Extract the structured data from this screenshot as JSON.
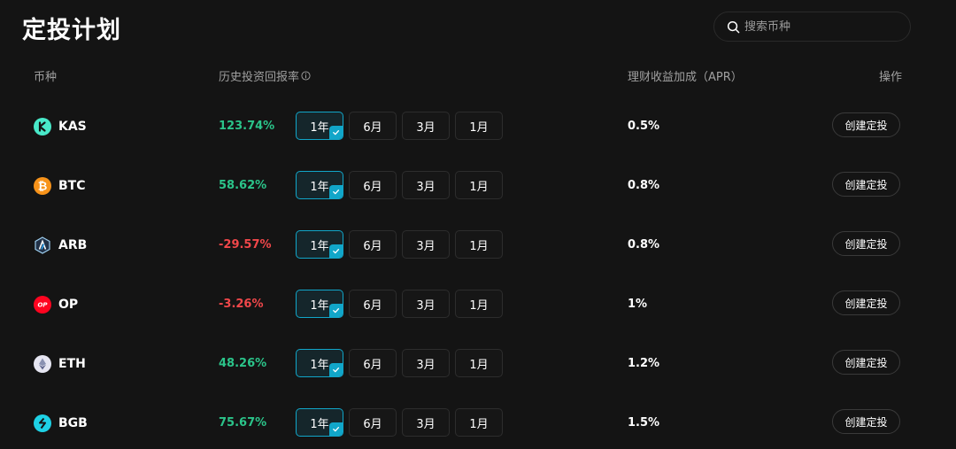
{
  "page": {
    "title": "定投计划"
  },
  "search": {
    "placeholder": "搜索币种"
  },
  "table": {
    "headers": {
      "coin": "币种",
      "return": "历史投资回报率",
      "apr": "理财收益加成（APR）",
      "action": "操作"
    },
    "period_options": [
      "1年",
      "6月",
      "3月",
      "1月"
    ],
    "action_label": "创建定投",
    "rows": [
      {
        "coin": "KAS",
        "return": "123.74%",
        "trend": "pos",
        "apr": "0.5%",
        "selected_period": "1年",
        "icon": "kas-icon"
      },
      {
        "coin": "BTC",
        "return": "58.62%",
        "trend": "pos",
        "apr": "0.8%",
        "selected_period": "1年",
        "icon": "btc-icon"
      },
      {
        "coin": "ARB",
        "return": "-29.57%",
        "trend": "neg",
        "apr": "0.8%",
        "selected_period": "1年",
        "icon": "arb-icon"
      },
      {
        "coin": "OP",
        "return": "-3.26%",
        "trend": "neg",
        "apr": "1%",
        "selected_period": "1年",
        "icon": "op-icon"
      },
      {
        "coin": "ETH",
        "return": "48.26%",
        "trend": "pos",
        "apr": "1.2%",
        "selected_period": "1年",
        "icon": "eth-icon"
      },
      {
        "coin": "BGB",
        "return": "75.67%",
        "trend": "pos",
        "apr": "1.5%",
        "selected_period": "1年",
        "icon": "bgb-icon"
      }
    ]
  },
  "colors": {
    "background": "#141414",
    "positive": "#2bc48a",
    "negative": "#f0474a",
    "accent": "#11a6c9"
  }
}
